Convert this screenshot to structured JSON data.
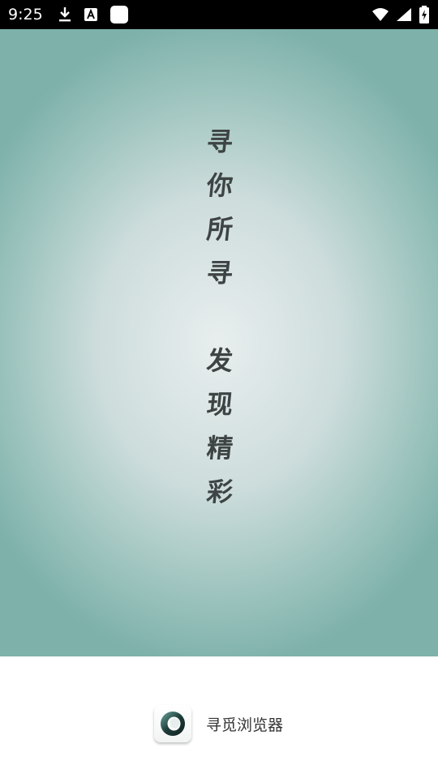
{
  "status_bar": {
    "time": "9:25",
    "left_icons": [
      "download-icon",
      "text-a-icon",
      "blank-square-icon"
    ],
    "right_icons": [
      "wifi-icon",
      "cell-signal-icon",
      "battery-charging-icon"
    ]
  },
  "splash": {
    "slogan_line_1": [
      "寻",
      "你",
      "所",
      "寻"
    ],
    "slogan_line_2": [
      "发",
      "现",
      "精",
      "彩"
    ]
  },
  "brand": {
    "app_name": "寻觅浏览器",
    "icon": "app-logo-icon"
  },
  "colors": {
    "gradient_center": "#e8eeee",
    "gradient_edge": "#7db1aa",
    "slogan_text": "#3e4443"
  }
}
